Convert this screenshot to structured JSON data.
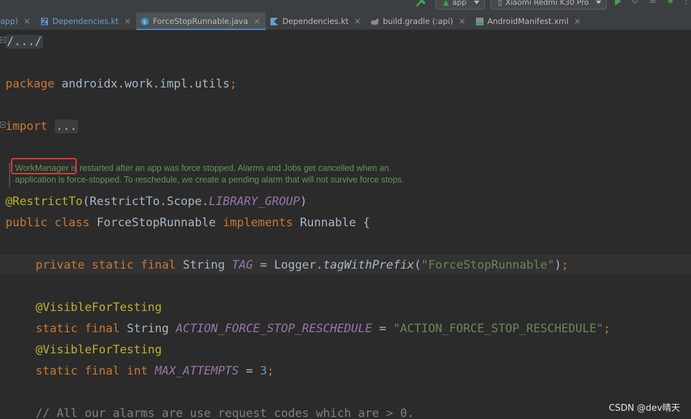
{
  "toolbar": {
    "run_config": "app",
    "device": "Xiaomi Redmi K30 Pro"
  },
  "tabs": [
    {
      "label": "(:app)",
      "icon": "kotlin-file-icon",
      "state": "inactive",
      "truncated_left": true
    },
    {
      "label": "Dependencies.kt",
      "icon": "kotlin-file-icon",
      "state": "inactive"
    },
    {
      "label": "ForceStopRunnable.java",
      "icon": "java-class-icon",
      "state": "active"
    },
    {
      "label": "Dependencies.kt",
      "icon": "kotlin-file-icon",
      "state": "inactive"
    },
    {
      "label": "build.gradle (:api)",
      "icon": "gradle-icon",
      "state": "inactive"
    },
    {
      "label": "AndroidManifest.xml",
      "icon": "manifest-icon",
      "state": "inactive"
    }
  ],
  "code": {
    "license_fold": "/.../",
    "package_keyword": "package",
    "package_name": "androidx.work.impl.utils",
    "import_keyword": "import",
    "import_fold": "...",
    "doc_comment_ref": "WorkManager",
    "doc_comment_line1": " is restarted after an app was force stopped. Alarms and Jobs get cancelled when an",
    "doc_comment_line2": "application is force-stopped. To reschedule, we create a pending alarm that will not survive force stops.",
    "annotation_restrict": "@RestrictTo",
    "restrict_arg_class": "RestrictTo",
    "restrict_arg_scope": "Scope",
    "restrict_arg_const": "LIBRARY_GROUP",
    "class_public": "public",
    "class_class": "class",
    "class_name": "ForceStopRunnable",
    "class_implements": "implements",
    "class_interface": "Runnable",
    "tag_modifiers": "private static final",
    "tag_type": "String",
    "tag_name": "TAG",
    "tag_logger": "Logger",
    "tag_method": "tagWithPrefix",
    "tag_value": "\"ForceStopRunnable\"",
    "visible_annotation": "@VisibleForTesting",
    "action_modifiers": "static final",
    "action_type": "String",
    "action_name": "ACTION_FORCE_STOP_RESCHEDULE",
    "action_value": "\"ACTION_FORCE_STOP_RESCHEDULE\"",
    "max_modifiers": "static final",
    "max_type": "int",
    "max_name": "MAX_ATTEMPTS",
    "max_value": "3",
    "comment_line": "// All our alarms are use request codes which are > 0."
  },
  "watermark": "CSDN @dev晴天",
  "colors": {
    "keyword": "#cc7832",
    "annotation": "#bbb529",
    "string": "#6a8759",
    "field": "#9876aa",
    "number": "#6897bb",
    "doc": "#629755",
    "highlight": "#e53935"
  }
}
